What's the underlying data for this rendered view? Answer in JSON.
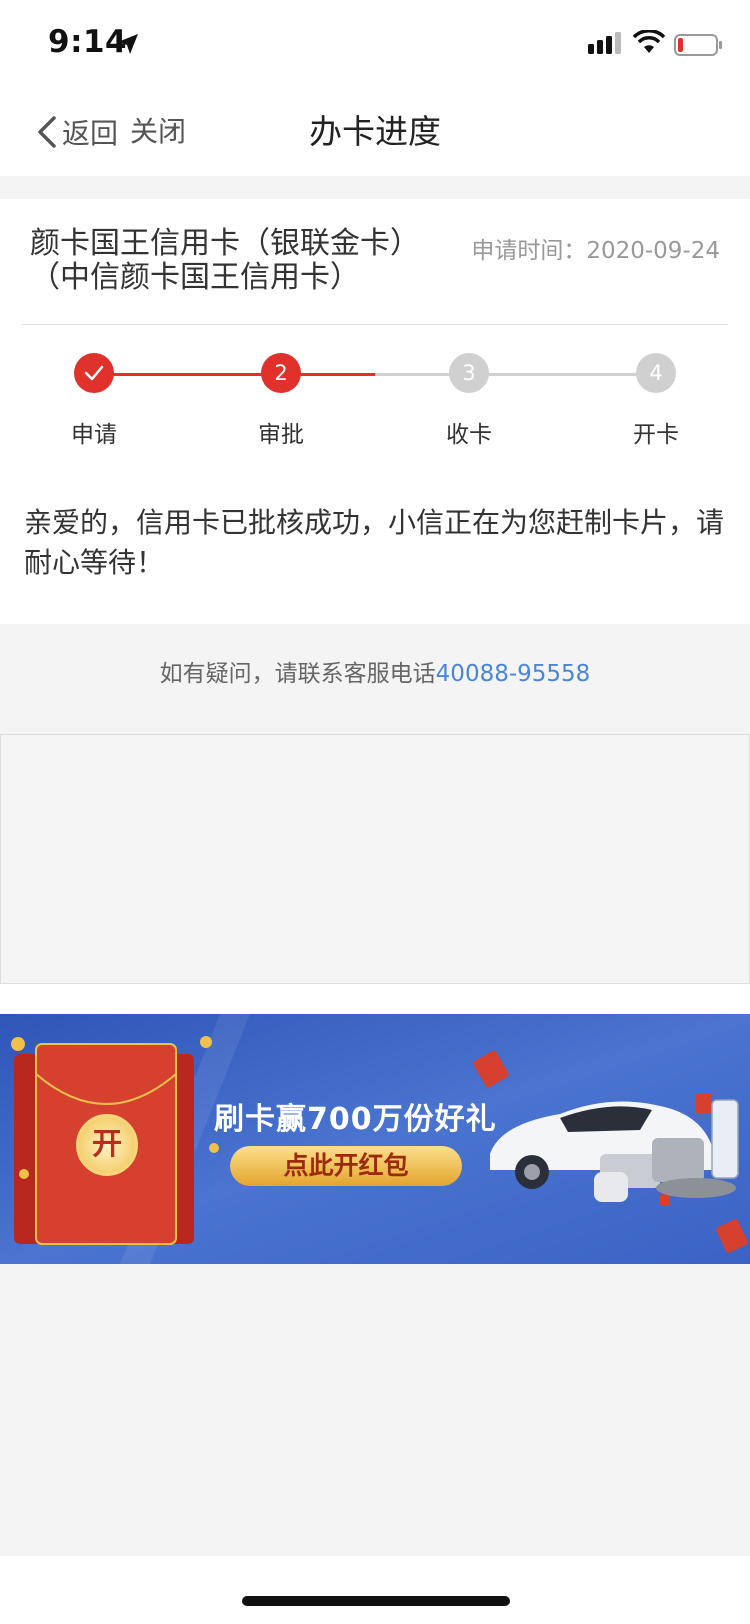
{
  "status_bar": {
    "time": "9:14",
    "icons": [
      "location-arrow-icon",
      "cellular-signal-icon",
      "wifi-icon",
      "battery-low-icon"
    ]
  },
  "nav": {
    "back_label": "返回",
    "close_label": "关闭",
    "title": "办卡进度"
  },
  "card": {
    "name": "颜卡国王信用卡（银联金卡）（中信颜卡国王信用卡）",
    "apply_time": "申请时间：2020-09-24"
  },
  "steps": [
    {
      "label": "申请",
      "number": "",
      "state": "done"
    },
    {
      "label": "审批",
      "number": "2",
      "state": "current"
    },
    {
      "label": "收卡",
      "number": "3",
      "state": "pending"
    },
    {
      "label": "开卡",
      "number": "4",
      "state": "pending"
    }
  ],
  "message": "亲爱的，信用卡已批核成功，小信正在为您赶制卡片，请耐心等待！",
  "help": {
    "text": "如有疑问，请联系客服电话",
    "phone": "40088-95558"
  },
  "banner": {
    "title": "刷卡赢700万份好礼",
    "button_label": "点此开红包",
    "envelope_label": "开"
  },
  "colors": {
    "accent_red": "#e0322a",
    "link_blue": "#4a86d8",
    "banner_blue": "#3f68c8",
    "pending_grey": "#d0d0d0"
  }
}
